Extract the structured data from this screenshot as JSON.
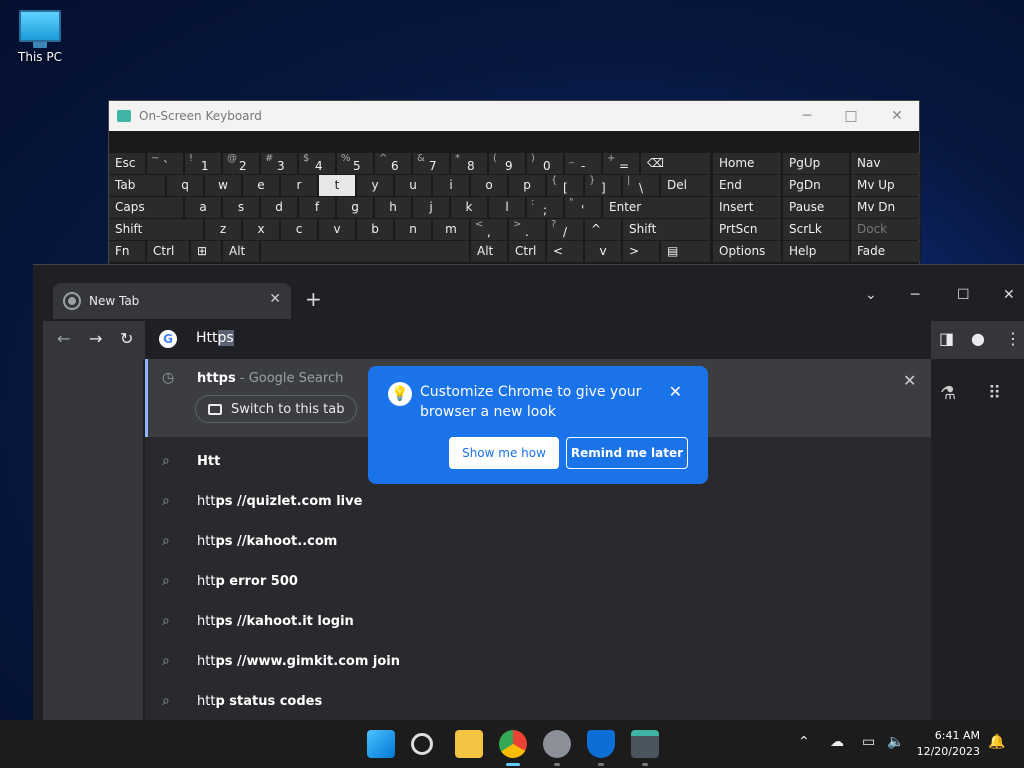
{
  "desktop": {
    "icon_label": "This PC"
  },
  "osk": {
    "title": "On-Screen Keyboard",
    "rows": [
      [
        {
          "l": "Esc"
        },
        {
          "s": "~",
          "m": "`"
        },
        {
          "s": "!",
          "m": "1"
        },
        {
          "s": "@",
          "m": "2"
        },
        {
          "s": "#",
          "m": "3"
        },
        {
          "s": "$",
          "m": "4"
        },
        {
          "s": "%",
          "m": "5"
        },
        {
          "s": "^",
          "m": "6"
        },
        {
          "s": "&",
          "m": "7"
        },
        {
          "s": "*",
          "m": "8"
        },
        {
          "s": "(",
          "m": "9"
        },
        {
          "s": ")",
          "m": "0"
        },
        {
          "s": "_",
          "m": "-"
        },
        {
          "s": "+",
          "m": "="
        },
        {
          "l": "⌫"
        },
        {
          "l": "Home"
        },
        {
          "l": "PgUp"
        },
        {
          "l": "Nav"
        }
      ],
      [
        {
          "l": "Tab"
        },
        {
          "l": "q"
        },
        {
          "l": "w"
        },
        {
          "l": "e"
        },
        {
          "l": "r"
        },
        {
          "l": "t"
        },
        {
          "l": "y"
        },
        {
          "l": "u"
        },
        {
          "l": "i"
        },
        {
          "l": "o"
        },
        {
          "l": "p"
        },
        {
          "s": "{",
          "m": "["
        },
        {
          "s": "}",
          "m": "]"
        },
        {
          "s": "|",
          "m": "\\"
        },
        {
          "l": "Del"
        },
        {
          "l": "End"
        },
        {
          "l": "PgDn"
        },
        {
          "l": "Mv Up"
        }
      ],
      [
        {
          "l": "Caps"
        },
        {
          "l": "a"
        },
        {
          "l": "s"
        },
        {
          "l": "d"
        },
        {
          "l": "f"
        },
        {
          "l": "g"
        },
        {
          "l": "h"
        },
        {
          "l": "j"
        },
        {
          "l": "k"
        },
        {
          "l": "l"
        },
        {
          "s": ":",
          "m": ";"
        },
        {
          "s": "\"",
          "m": "'"
        },
        {
          "l": "Enter"
        },
        {
          "l": "Insert"
        },
        {
          "l": "Pause"
        },
        {
          "l": "Mv Dn"
        }
      ],
      [
        {
          "l": "Shift"
        },
        {
          "l": "z"
        },
        {
          "l": "x"
        },
        {
          "l": "c"
        },
        {
          "l": "v"
        },
        {
          "l": "b"
        },
        {
          "l": "n"
        },
        {
          "l": "m"
        },
        {
          "s": "<",
          "m": ","
        },
        {
          "s": ">",
          "m": "."
        },
        {
          "s": "?",
          "m": "/"
        },
        {
          "l": "^"
        },
        {
          "l": "Shift"
        },
        {
          "l": "PrtScn"
        },
        {
          "l": "ScrLk"
        },
        {
          "l": "Dock"
        }
      ],
      [
        {
          "l": "Fn"
        },
        {
          "l": "Ctrl"
        },
        {
          "l": "⊞"
        },
        {
          "l": "Alt"
        },
        {
          "l": ""
        },
        {
          "l": "Alt"
        },
        {
          "l": "Ctrl"
        },
        {
          "l": "<"
        },
        {
          "l": "v"
        },
        {
          "l": ">"
        },
        {
          "l": "▤"
        },
        {
          "l": "Options"
        },
        {
          "l": "Help"
        },
        {
          "l": "Fade"
        }
      ]
    ]
  },
  "chrome": {
    "tab_title": "New Tab",
    "omnibox_typed": "Htt",
    "omnibox_selected": "ps",
    "top_suggestion": {
      "bold": "https",
      "sub": " - Google Search"
    },
    "switch_tab": "Switch to this tab",
    "suggestions": [
      {
        "bold": "Htt",
        "rest": ""
      },
      {
        "bold": "htt",
        "rest": "ps //quizlet.com live"
      },
      {
        "bold": "htt",
        "rest": "ps //kahoot..com"
      },
      {
        "bold": "htt",
        "rest": "p error 500"
      },
      {
        "bold": "htt",
        "rest": "ps //kahoot.it login"
      },
      {
        "bold": "htt",
        "rest": "ps //www.gimkit.com join"
      },
      {
        "bold": "htt",
        "rest": "p status codes"
      }
    ],
    "callout": {
      "message": "Customize Chrome to give your browser a new look",
      "show_me_how": "Show me how",
      "remind_later": "Remind me later"
    }
  },
  "taskbar": {
    "time": "6:41 AM",
    "date": "12/20/2023"
  }
}
